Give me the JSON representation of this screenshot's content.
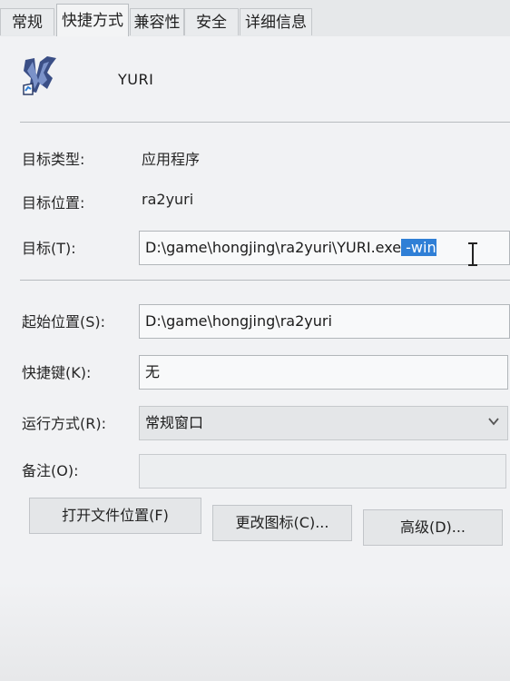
{
  "tabs": [
    {
      "label": "常规"
    },
    {
      "label": "快捷方式"
    },
    {
      "label": "兼容性"
    },
    {
      "label": "安全"
    },
    {
      "label": "详细信息"
    }
  ],
  "shortcut": {
    "name": "YURI",
    "icon": "yuri-app-icon",
    "target_type_label": "目标类型:",
    "target_type_value": "应用程序",
    "target_location_label": "目标位置:",
    "target_location_value": "ra2yuri",
    "target_label": "目标(T):",
    "target_value_main": "D:\\game\\hongjing\\ra2yuri\\YURI.exe",
    "target_value_selected": " -win",
    "start_in_label": "起始位置(S):",
    "start_in_value": "D:\\game\\hongjing\\ra2yuri",
    "hotkey_label": "快捷键(K):",
    "hotkey_value": "无",
    "run_label": "运行方式(R):",
    "run_value": "常规窗口",
    "comment_label": "备注(O):",
    "comment_value": ""
  },
  "buttons": {
    "open_location": "打开文件位置(F)",
    "change_icon": "更改图标(C)...",
    "advanced": "高级(D)..."
  },
  "colors": {
    "selection": "#2f7fd6"
  }
}
